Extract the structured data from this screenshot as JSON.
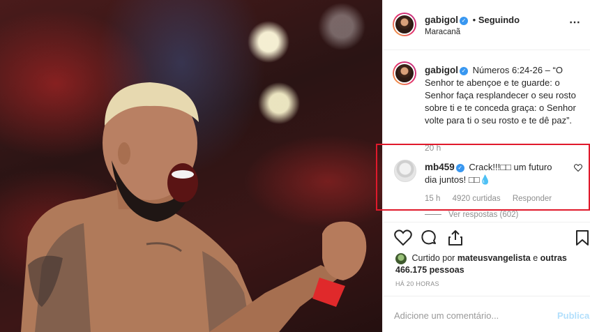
{
  "post": {
    "username": "gabigol",
    "follow_status": "Seguindo",
    "separator": "•",
    "location": "Maracanã",
    "more_icon": "⋯",
    "caption": "Números 6:24-26 – “O Senhor te abençoe e te guarde: o Senhor faça resplandecer o seu rosto sobre ti e te conceda graça: o Senhor volte para ti o seu rosto e te dê paz”.",
    "caption_time": "20 h"
  },
  "comment": {
    "username": "mb459",
    "text": "Crack!!!□□ um futuro dia juntos! □□💧",
    "time": "15 h",
    "likes": "4920 curtidas",
    "reply": "Responder",
    "view_replies": "Ver respostas (602)",
    "highlight_color": "#e0192b"
  },
  "likes": {
    "prefix": "Curtido por",
    "user": "mateusvangelista",
    "middle": "e",
    "others": "outras 466.175 pessoas"
  },
  "timestamp": "HÁ 20 HORAS",
  "composer": {
    "placeholder": "Adicione um comentário...",
    "publish": "Publicar"
  },
  "icons": [
    "heart-icon",
    "comment-icon",
    "share-icon",
    "bookmark-icon",
    "verified-icon"
  ],
  "colors": {
    "verified": "#3897f0",
    "muted": "#8e8e8e",
    "publish_disabled": "#b2dffc"
  }
}
